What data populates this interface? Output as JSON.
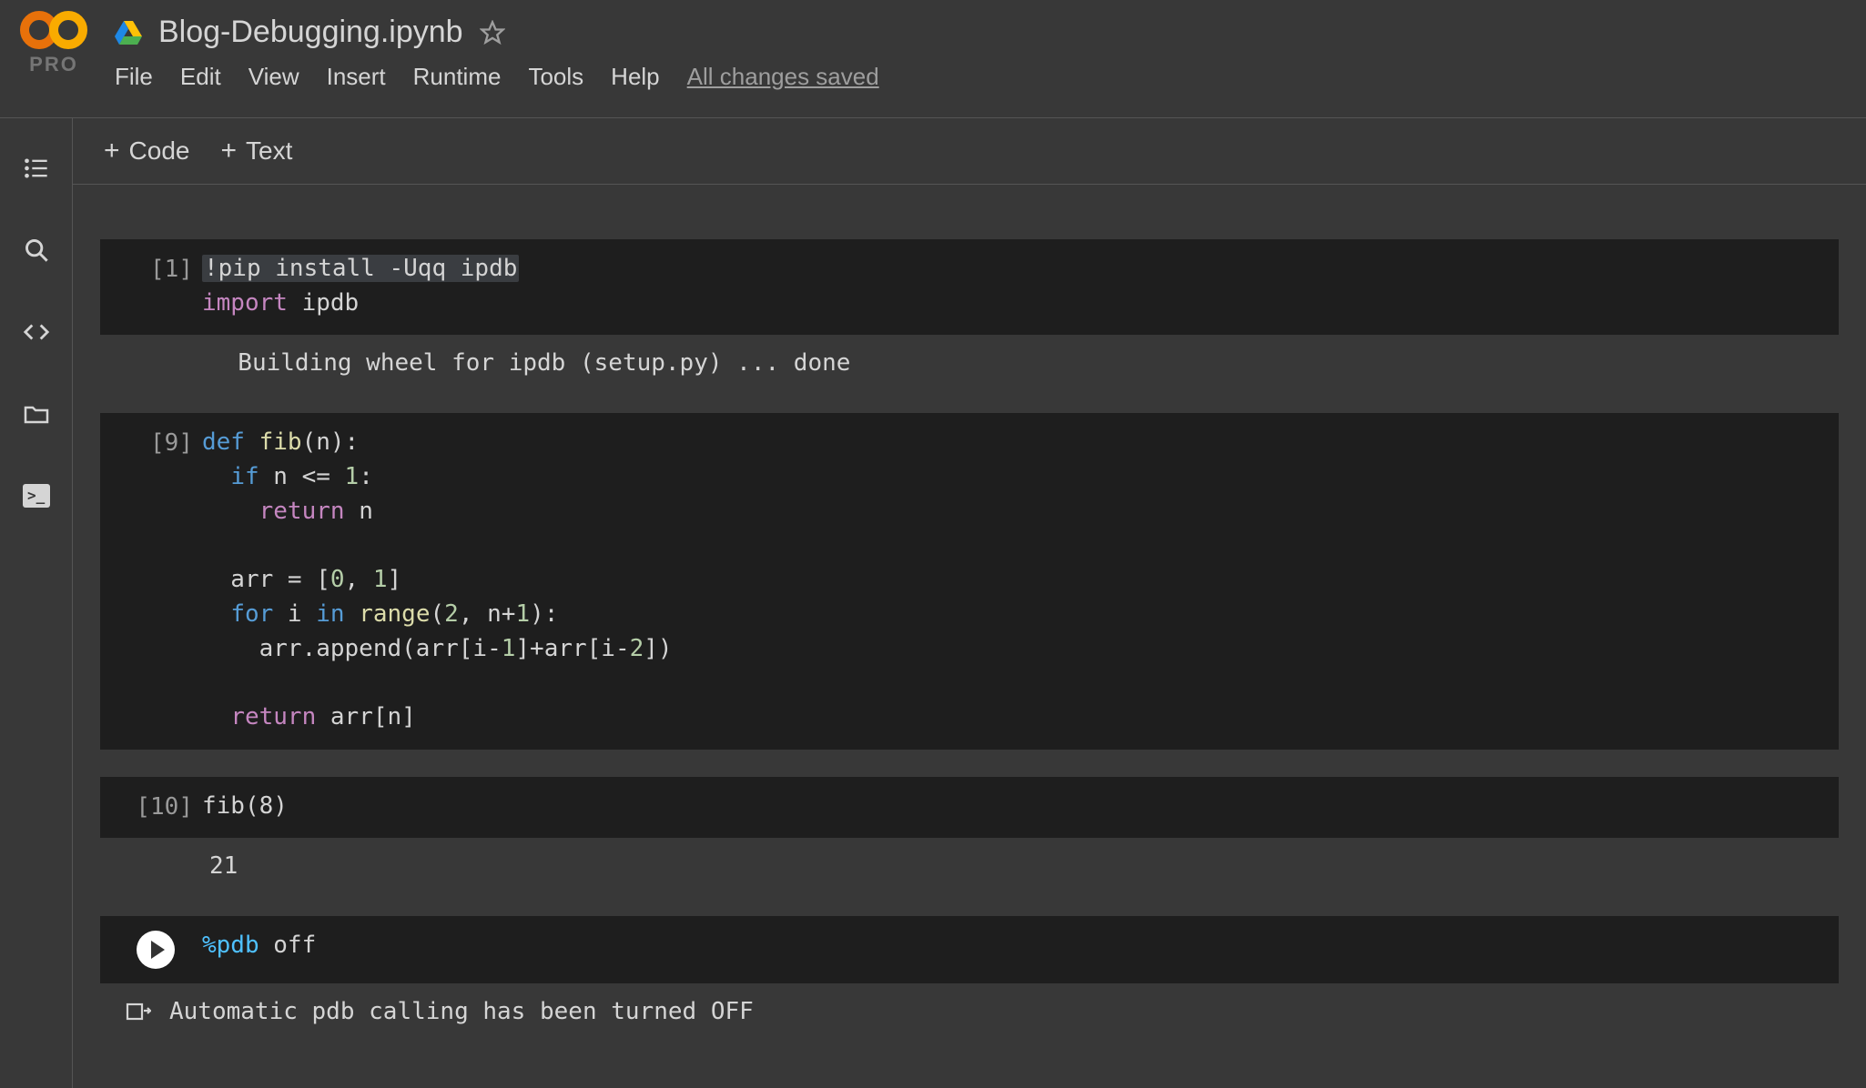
{
  "header": {
    "pro_label": "PRO",
    "doc_title": "Blog-Debugging.ipynb",
    "save_status": "All changes saved"
  },
  "menu": {
    "file": "File",
    "edit": "Edit",
    "view": "View",
    "insert": "Insert",
    "runtime": "Runtime",
    "tools": "Tools",
    "help": "Help"
  },
  "toolbar": {
    "code_label": "Code",
    "text_label": "Text"
  },
  "cells": {
    "c1": {
      "exec": "[1]",
      "output": "  Building wheel for ipdb (setup.py) ... done"
    },
    "c2": {
      "exec": "[9]"
    },
    "c3": {
      "exec": "[10]",
      "code": "fib(8)",
      "output": "21"
    },
    "c4": {
      "output": "Automatic pdb calling has been turned OFF"
    }
  }
}
